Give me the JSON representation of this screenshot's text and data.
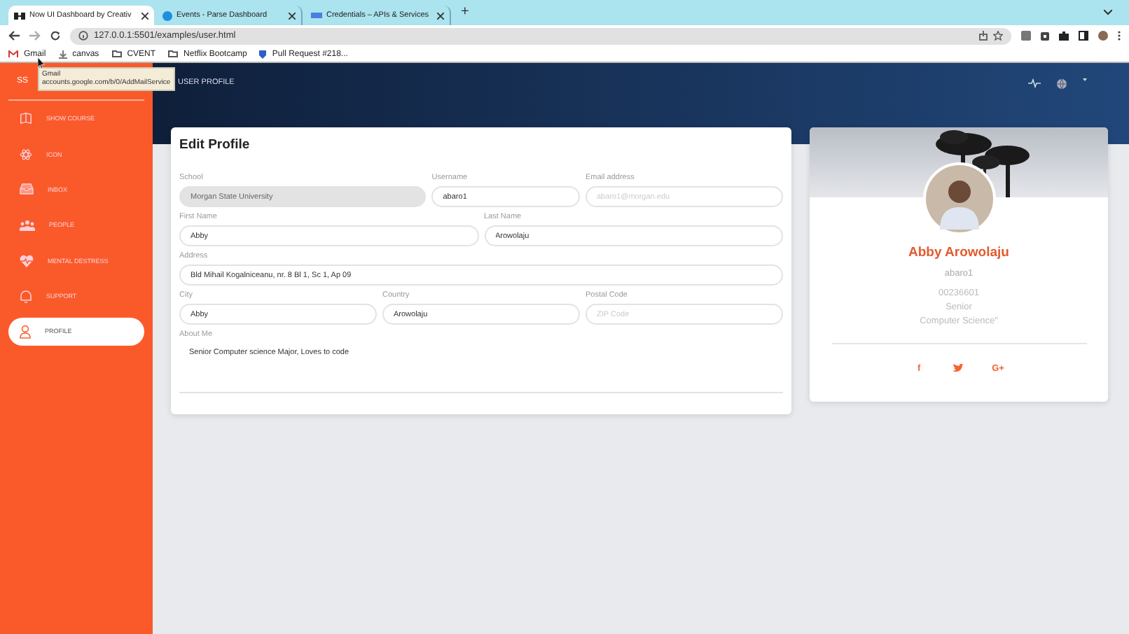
{
  "browser": {
    "tabs": [
      {
        "title": "Now UI Dashboard by Creativ",
        "kind": "dashboard",
        "selected": true
      },
      {
        "title": "Events - Parse Dashboard",
        "kind": "parse",
        "selected": false
      },
      {
        "title": "Credentials – APIs & Services",
        "kind": "api",
        "selected": false
      }
    ],
    "new_tab": "+",
    "url": "127.0.0.1:5501/examples/user.html",
    "bookmarks": [
      {
        "label": "Gmail",
        "kind": "gmail"
      },
      {
        "label": "canvas",
        "kind": "canvas"
      },
      {
        "label": "CVENT",
        "kind": "folder"
      },
      {
        "label": "Netflix Bootcamp",
        "kind": "folder"
      },
      {
        "label": "Pull Request #218...",
        "kind": "pr"
      }
    ],
    "tooltip": {
      "title": "Gmail",
      "url": "accounts.google.com/b/0/AddMailService"
    }
  },
  "sidebar": {
    "logo": "SS",
    "items": [
      {
        "label": "SHOW COURSE",
        "kind": "book",
        "selected": false
      },
      {
        "label": "ICON",
        "kind": "atom",
        "selected": false
      },
      {
        "label": "INBOX",
        "kind": "inbox",
        "selected": false
      },
      {
        "label": "PEOPLE",
        "kind": "people",
        "selected": false
      },
      {
        "label": "MENTAL DESTRESS",
        "kind": "heart",
        "selected": false
      },
      {
        "label": "SUPPORT",
        "kind": "bell",
        "selected": false
      },
      {
        "label": "PROFILE",
        "kind": "user",
        "selected": true
      }
    ]
  },
  "header": {
    "title": "USER PROFILE"
  },
  "edit_profile": {
    "title": "Edit Profile",
    "rows": [
      [
        {
          "label": "School",
          "value": "Morgan State University",
          "disabled": true
        },
        {
          "label": "Username",
          "value": "abaro1",
          "disabled": false
        },
        {
          "label": "Email address",
          "placeholder": "abaro1@morgan.edu",
          "disabled": false
        }
      ],
      [
        {
          "label": "First Name",
          "value": "Abby",
          "disabled": false
        },
        {
          "label": "Last Name",
          "value": "Arowolaju",
          "disabled": false
        }
      ],
      [
        {
          "label": "Address",
          "value": "Bld Mihail Kogalniceanu, nr. 8 Bl 1, Sc 1, Ap 09",
          "disabled": false
        }
      ],
      [
        {
          "label": "City",
          "value": "Abby",
          "disabled": false
        },
        {
          "label": "Country",
          "value": "Arowolaju",
          "disabled": false
        },
        {
          "label": "Postal Code",
          "placeholder": "ZIP Code",
          "disabled": false
        }
      ]
    ],
    "about": {
      "label": "About Me",
      "value": "Senior Computer science Major, Loves to code"
    }
  },
  "profile_card": {
    "name": "Abby Arowolaju",
    "username": "abaro1",
    "details": [
      "00236601",
      "Senior",
      "Computer Science\""
    ],
    "social": [
      {
        "kind": "facebook",
        "label": "f"
      },
      {
        "kind": "twitter"
      },
      {
        "kind": "google",
        "label": "G+"
      }
    ]
  }
}
